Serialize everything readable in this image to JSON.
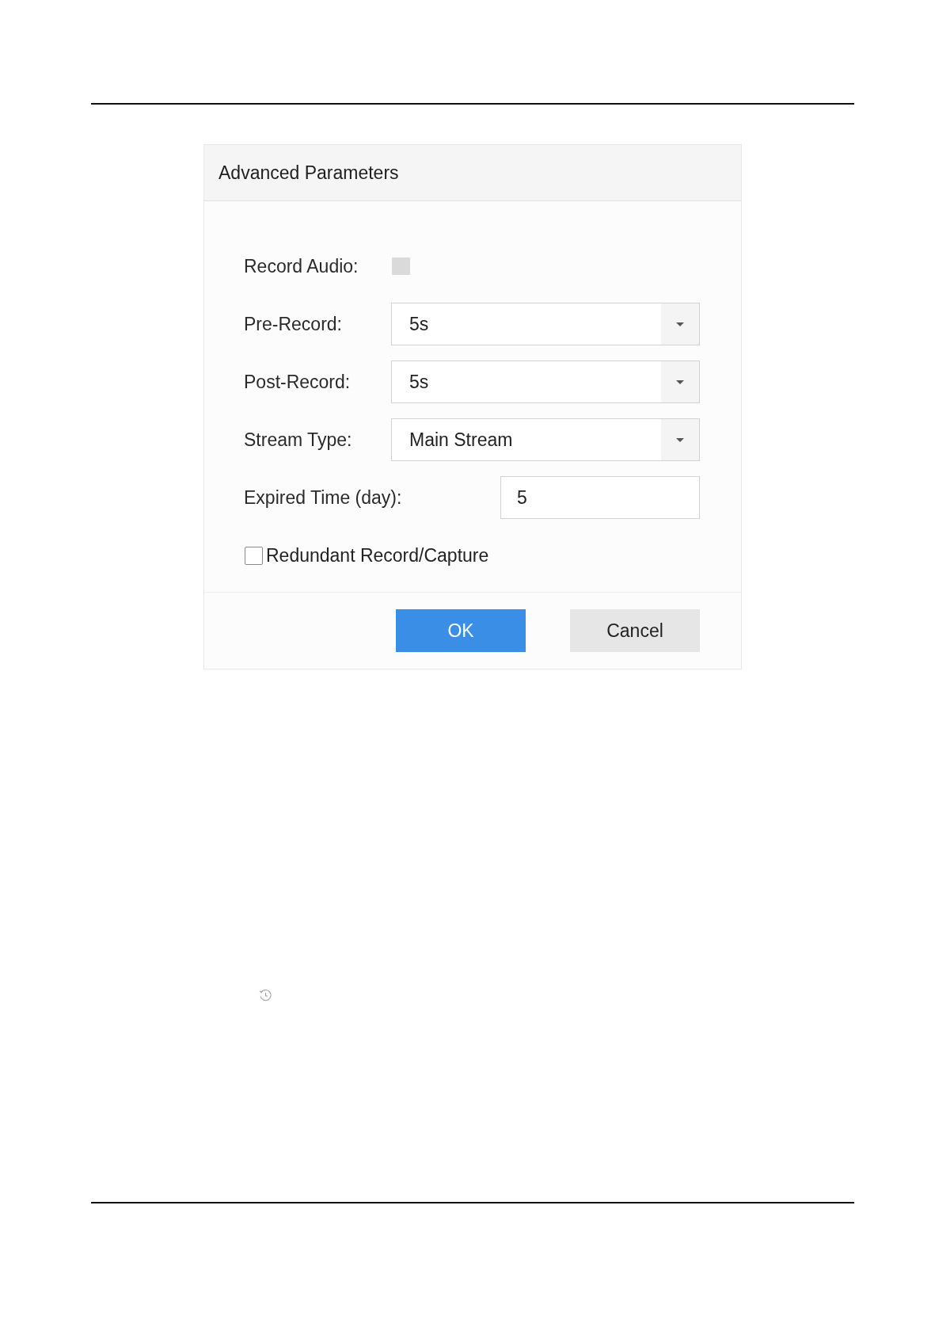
{
  "dialog": {
    "title": "Advanced Parameters",
    "fields": [
      {
        "kind": "toggle",
        "label": "Record Audio:",
        "checked": false
      },
      {
        "kind": "select",
        "label": "Pre-Record:",
        "value": "5s"
      },
      {
        "kind": "select",
        "label": "Post-Record:",
        "value": "5s"
      },
      {
        "kind": "select",
        "label": "Stream Type:",
        "value": "Main Stream"
      },
      {
        "kind": "input",
        "label": "Expired Time (day):",
        "value": "5"
      },
      {
        "kind": "checkbox",
        "label": "Redundant Record/Capture",
        "checked": false
      }
    ],
    "buttons": [
      {
        "kind": "primary",
        "label": "OK"
      },
      {
        "kind": "secondary",
        "label": "Cancel"
      }
    ]
  }
}
